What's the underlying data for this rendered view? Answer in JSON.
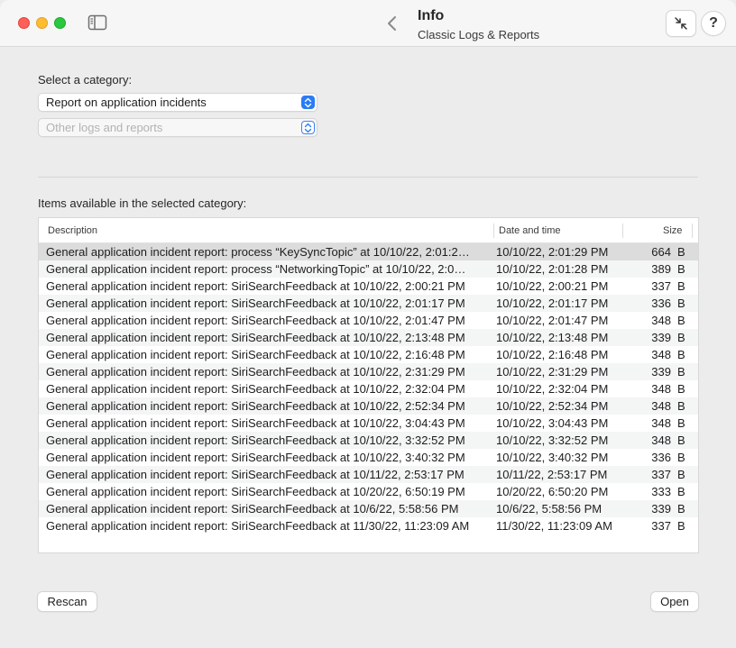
{
  "titlebar": {
    "title": "Info",
    "subtitle": "Classic Logs & Reports",
    "help_label": "?"
  },
  "category": {
    "label": "Select a category:",
    "selected_value": "Report on application incidents",
    "secondary_placeholder": "Other logs and reports"
  },
  "items": {
    "label": "Items available in the selected category:",
    "columns": {
      "description": "Description",
      "date": "Date and time",
      "size": "Size"
    },
    "rows": [
      {
        "description": "General application incident report: process “KeySyncTopic” at 10/10/22, 2:01:2…",
        "date": "10/10/22, 2:01:29 PM",
        "size": "664",
        "unit": "B"
      },
      {
        "description": "General application incident report: process “NetworkingTopic” at 10/10/22, 2:0…",
        "date": "10/10/22, 2:01:28 PM",
        "size": "389",
        "unit": "B"
      },
      {
        "description": "General application incident report: SiriSearchFeedback at 10/10/22, 2:00:21 PM",
        "date": "10/10/22, 2:00:21 PM",
        "size": "337",
        "unit": "B"
      },
      {
        "description": "General application incident report: SiriSearchFeedback at 10/10/22, 2:01:17 PM",
        "date": "10/10/22, 2:01:17 PM",
        "size": "336",
        "unit": "B"
      },
      {
        "description": "General application incident report: SiriSearchFeedback at 10/10/22, 2:01:47 PM",
        "date": "10/10/22, 2:01:47 PM",
        "size": "348",
        "unit": "B"
      },
      {
        "description": "General application incident report: SiriSearchFeedback at 10/10/22, 2:13:48 PM",
        "date": "10/10/22, 2:13:48 PM",
        "size": "339",
        "unit": "B"
      },
      {
        "description": "General application incident report: SiriSearchFeedback at 10/10/22, 2:16:48 PM",
        "date": "10/10/22, 2:16:48 PM",
        "size": "348",
        "unit": "B"
      },
      {
        "description": "General application incident report: SiriSearchFeedback at 10/10/22, 2:31:29 PM",
        "date": "10/10/22, 2:31:29 PM",
        "size": "339",
        "unit": "B"
      },
      {
        "description": "General application incident report: SiriSearchFeedback at 10/10/22, 2:32:04 PM",
        "date": "10/10/22, 2:32:04 PM",
        "size": "348",
        "unit": "B"
      },
      {
        "description": "General application incident report: SiriSearchFeedback at 10/10/22, 2:52:34 PM",
        "date": "10/10/22, 2:52:34 PM",
        "size": "348",
        "unit": "B"
      },
      {
        "description": "General application incident report: SiriSearchFeedback at 10/10/22, 3:04:43 PM",
        "date": "10/10/22, 3:04:43 PM",
        "size": "348",
        "unit": "B"
      },
      {
        "description": "General application incident report: SiriSearchFeedback at 10/10/22, 3:32:52 PM",
        "date": "10/10/22, 3:32:52 PM",
        "size": "348",
        "unit": "B"
      },
      {
        "description": "General application incident report: SiriSearchFeedback at 10/10/22, 3:40:32 PM",
        "date": "10/10/22, 3:40:32 PM",
        "size": "336",
        "unit": "B"
      },
      {
        "description": "General application incident report: SiriSearchFeedback at 10/11/22, 2:53:17 PM",
        "date": "10/11/22, 2:53:17 PM",
        "size": "337",
        "unit": "B"
      },
      {
        "description": "General application incident report: SiriSearchFeedback at 10/20/22, 6:50:19 PM",
        "date": "10/20/22, 6:50:20 PM",
        "size": "333",
        "unit": "B"
      },
      {
        "description": "General application incident report: SiriSearchFeedback at 10/6/22, 5:58:56 PM",
        "date": "10/6/22, 5:58:56 PM",
        "size": "339",
        "unit": "B"
      },
      {
        "description": "General application incident report: SiriSearchFeedback at 11/30/22, 11:23:09 AM",
        "date": "11/30/22, 11:23:09 AM",
        "size": "337",
        "unit": "B"
      }
    ]
  },
  "buttons": {
    "rescan": "Rescan",
    "open": "Open"
  },
  "colors": {
    "accent": "#2a7cf6",
    "selected_row": "#dcdcdc"
  },
  "icons": {
    "close": "close-icon",
    "minimize": "minimize-icon",
    "maximize": "maximize-icon",
    "sidebar": "sidebar-toggle-icon",
    "back": "chevron-left-icon",
    "collapse": "collapse-arrows-icon",
    "popup": "chevron-updown-icon"
  }
}
